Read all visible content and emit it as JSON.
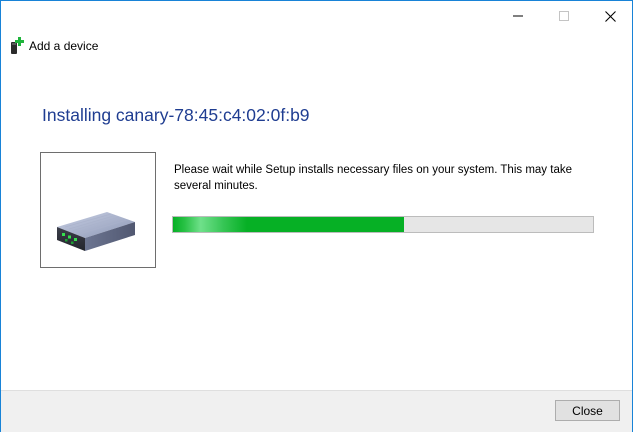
{
  "window": {
    "title": "Add a device",
    "caption_icons": [
      "minimize-icon",
      "maximize-icon",
      "close-icon"
    ]
  },
  "main": {
    "heading": "Installing canary-78:45:c4:02:0f:b9",
    "message": "Please wait while Setup installs necessary files on your system. This may take several minutes.",
    "device_icon": "router-device-icon",
    "progress_fraction": 0.55
  },
  "footer": {
    "close_label": "Close"
  },
  "colors": {
    "heading": "#1f3d91",
    "progress_fill": "#06b025",
    "progress_track": "#e6e6e6",
    "window_border": "#1883d7"
  }
}
